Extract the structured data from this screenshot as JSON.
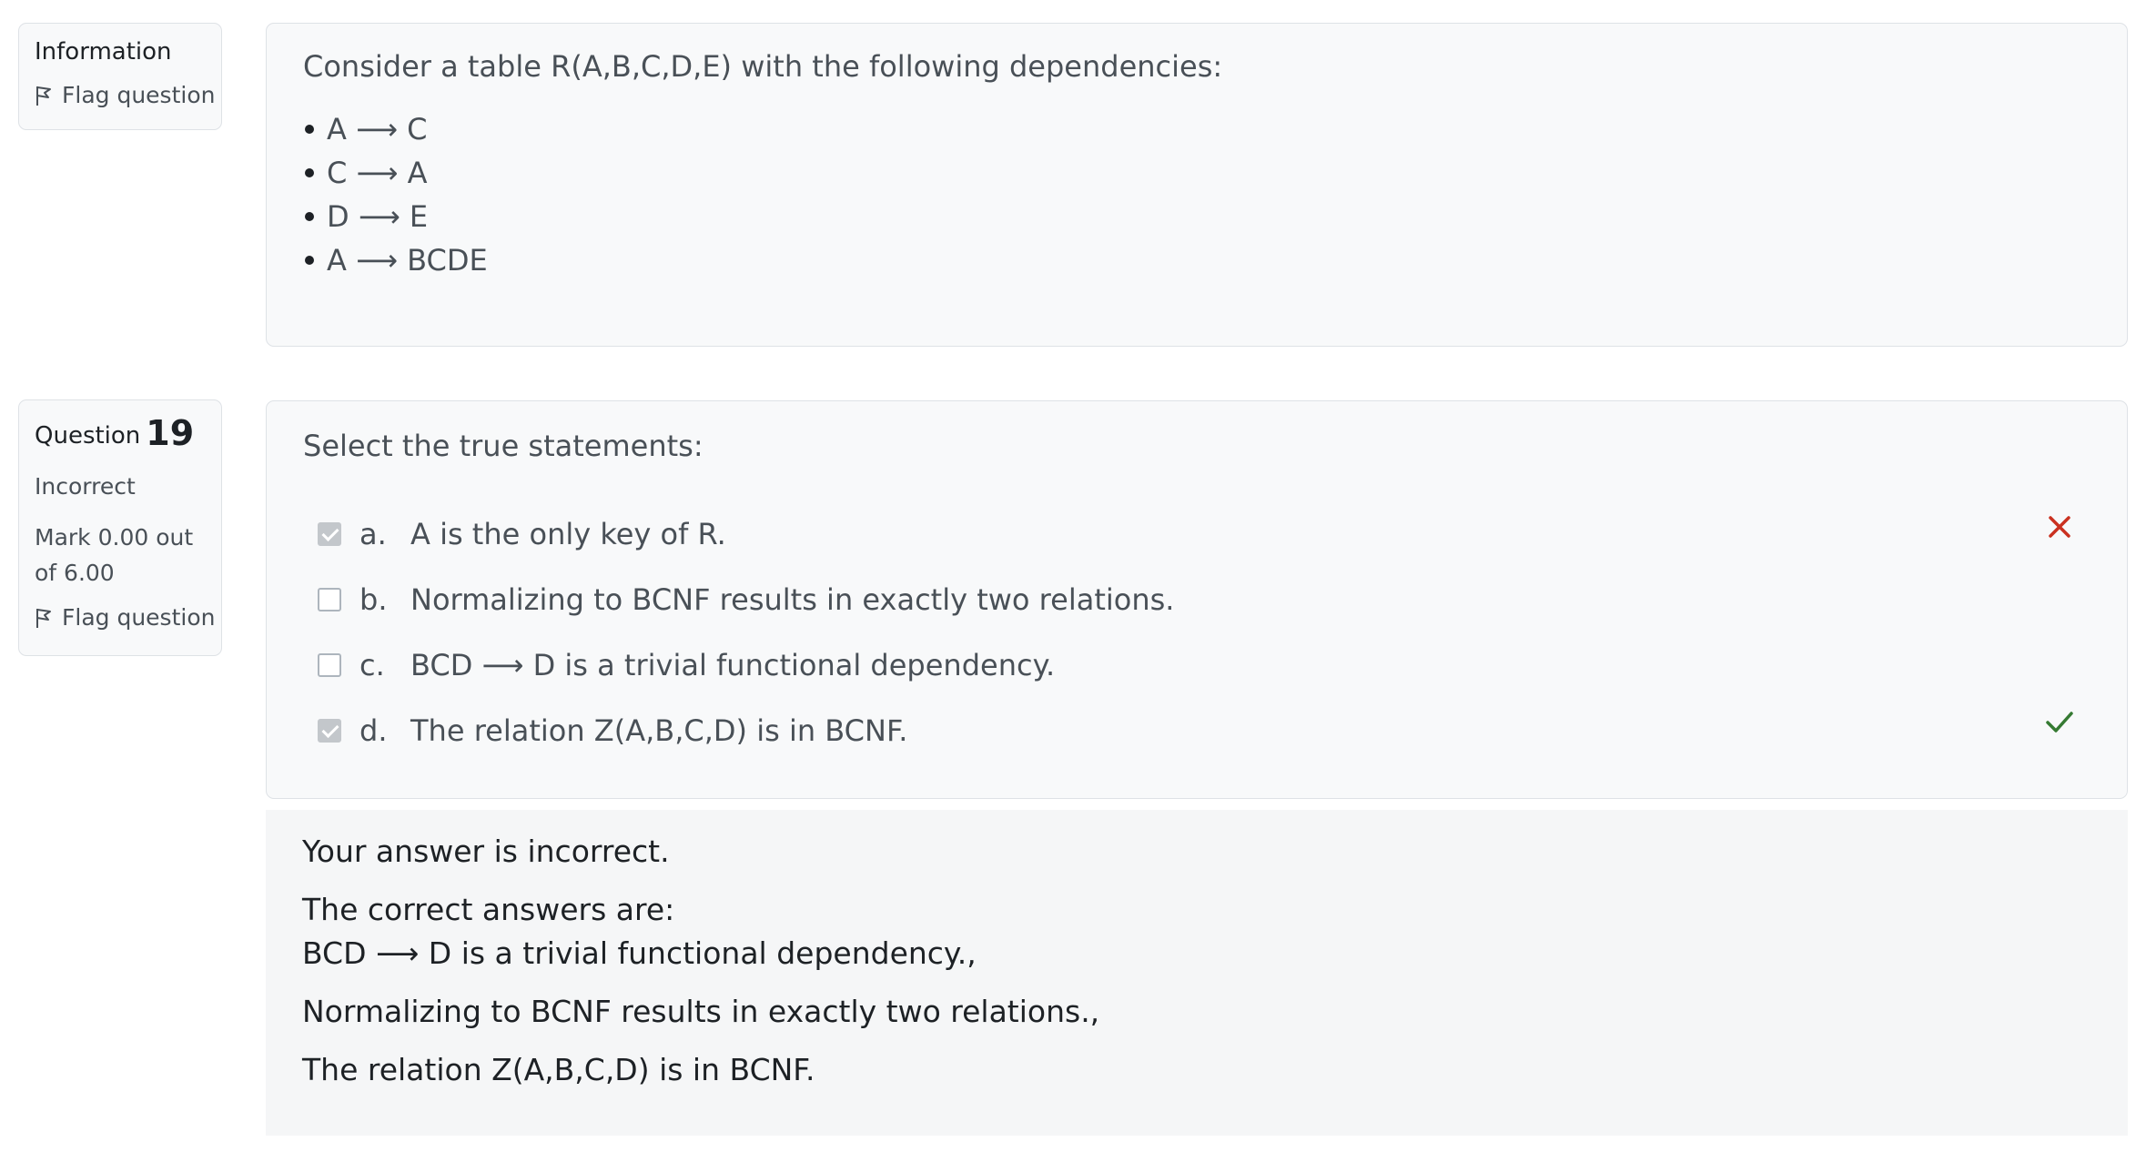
{
  "information": {
    "title": "Information",
    "flag_label": "Flag question"
  },
  "question": {
    "label": "Question",
    "number": "19",
    "status": "Incorrect",
    "mark_line1": "Mark 0.00 out",
    "mark_line2": "of 6.00",
    "flag_label": "Flag question"
  },
  "info_text": {
    "intro": "Consider a table R(A,B,C,D,E) with the following dependencies:",
    "dependencies": [
      "A ⟶ C",
      "C ⟶ A",
      "D ⟶ E",
      "A ⟶ BCDE"
    ]
  },
  "answer": {
    "prompt": "Select the true statements:",
    "options": [
      {
        "letter": "a.",
        "text": "A is the only key of R.",
        "checked": true,
        "mark": "incorrect"
      },
      {
        "letter": "b.",
        "text": "Normalizing to BCNF results in exactly two relations.",
        "checked": false,
        "mark": ""
      },
      {
        "letter": "c.",
        "text": "BCD ⟶ D is a trivial functional dependency.",
        "checked": false,
        "mark": ""
      },
      {
        "letter": "d.",
        "text": "The relation Z(A,B,C,D) is in BCNF.",
        "checked": true,
        "mark": "correct"
      }
    ]
  },
  "feedback": {
    "result": "Your answer is incorrect.",
    "correct_heading": "The correct answers are:",
    "answers": [
      "BCD ⟶ D is a trivial functional dependency.,",
      "Normalizing to BCNF results in exactly two relations.,",
      "The relation Z(A,B,C,D) is in BCNF."
    ]
  },
  "colors": {
    "incorrect": "#ca3120",
    "correct": "#357a32",
    "card_bg": "#f8f9fa",
    "border": "#dee2e6"
  },
  "icons": {
    "flag": "flag-icon",
    "incorrect": "cross-icon",
    "correct": "check-icon"
  }
}
